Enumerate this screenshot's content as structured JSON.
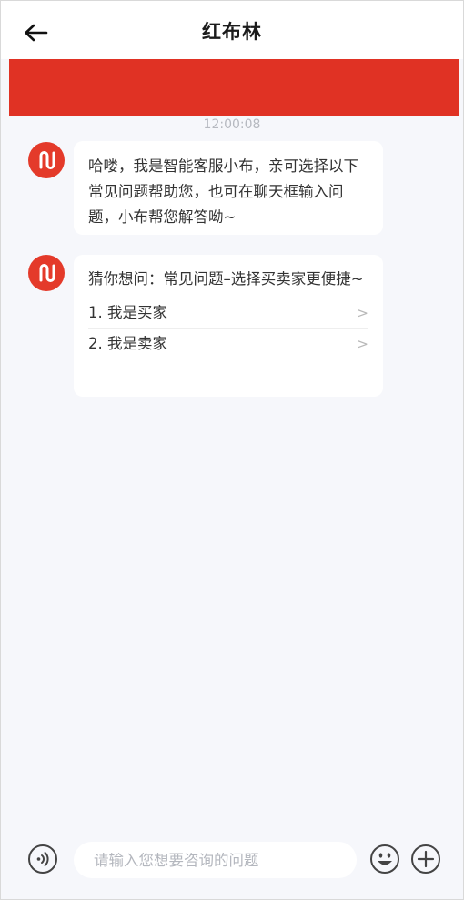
{
  "header": {
    "title": "红布林"
  },
  "chat": {
    "timestamp": "12:00:08",
    "messages": [
      {
        "text": "哈喽，我是智能客服小布，亲可选择以下常见问题帮助您，也可在聊天框输入问题，小布帮您解答呦~"
      },
      {
        "text": "猜你想问：常见问题–选择买卖家更便捷~",
        "options": [
          {
            "label": "1. 我是买家",
            "chevron": ">"
          },
          {
            "label": "2. 我是卖家",
            "chevron": ">"
          }
        ]
      }
    ]
  },
  "input": {
    "placeholder": "请输入您想要咨询的问题"
  },
  "colors": {
    "brand": "#e03224",
    "background": "#f6f7fb"
  }
}
